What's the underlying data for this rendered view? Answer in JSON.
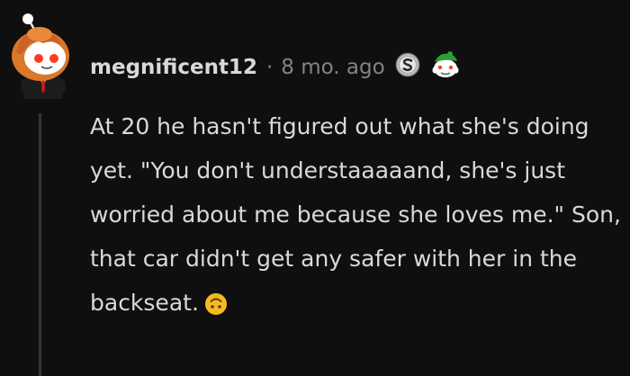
{
  "comment": {
    "username": "megnificent12",
    "separator": "·",
    "timestamp": "8 mo. ago",
    "awards": [
      {
        "icon": "silver-s-award-icon"
      },
      {
        "icon": "snoo-with-green-hat-award-icon"
      }
    ],
    "avatar_icon": "snoo-avatar-ginger-hair-suit-icon",
    "body_text": "At 20 he hasn't figured out what she's doing yet. \"You don't understaaaaand, she's just worried about me because she loves me.\" Son, that car didn't get any safer with her in the backseat.",
    "trailing_emoji": "upside-down-face-emoji-icon"
  },
  "colors": {
    "background": "#0f0f0f",
    "text_primary": "#d7dadc",
    "text_secondary": "#818384",
    "thread_line": "#343536",
    "emoji_yellow": "#f5b921"
  }
}
